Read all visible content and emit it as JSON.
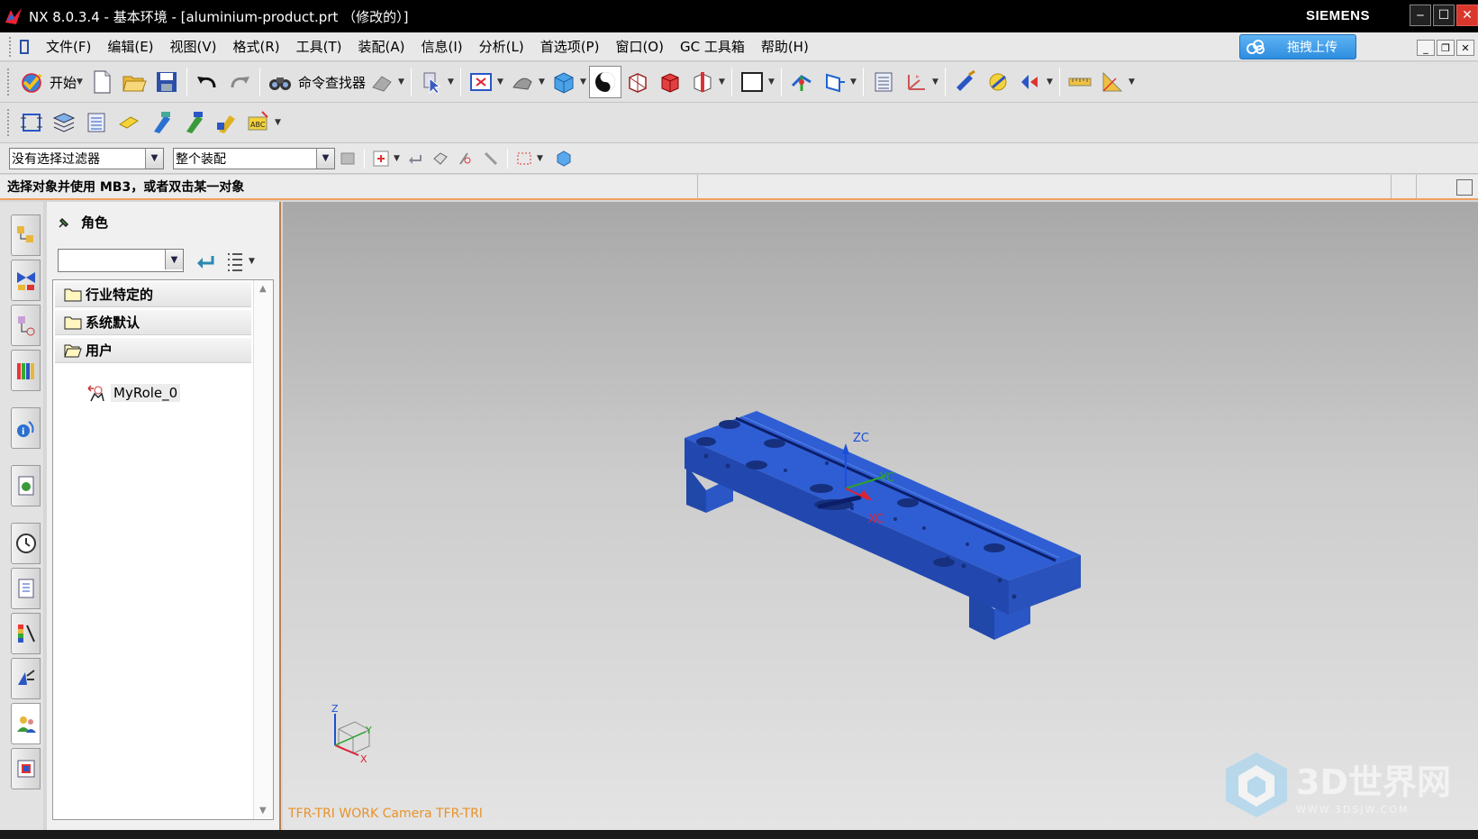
{
  "window": {
    "title": "NX 8.0.3.4 - 基本环境 - [aluminium-product.prt （修改的）]",
    "brand": "SIEMENS",
    "minimize": "‒",
    "maximize": "☐",
    "close": "✕"
  },
  "menu": {
    "items": [
      "文件(F)",
      "编辑(E)",
      "视图(V)",
      "格式(R)",
      "工具(T)",
      "装配(A)",
      "信息(I)",
      "分析(L)",
      "首选项(P)",
      "窗口(O)",
      "GC 工具箱",
      "帮助(H)"
    ],
    "upload_label": "拖拽上传"
  },
  "toolbar": {
    "start_label": "开始",
    "command_finder_label": "命令查找器"
  },
  "selection": {
    "filter_value": "没有选择过滤器",
    "scope_value": "整个装配"
  },
  "cue": {
    "text": "选择对象并使用 MB3，或者双击某一对象"
  },
  "navigator": {
    "title": "角色",
    "combo_value": "",
    "folders": [
      "行业特定的",
      "系统默认",
      "用户"
    ],
    "leaf": "MyRole_0"
  },
  "viewport": {
    "camera_label": "TFR-TRI WORK Camera TFR-TRI",
    "axis_labels": {
      "zc": "ZC",
      "yc": "YC",
      "xc": "XC",
      "z": "Z",
      "y": "Y",
      "x": "X"
    },
    "watermark": "3D世界网",
    "watermark_sub": "WWW.3DSJW.COM",
    "part_color": "#2a56c6"
  }
}
